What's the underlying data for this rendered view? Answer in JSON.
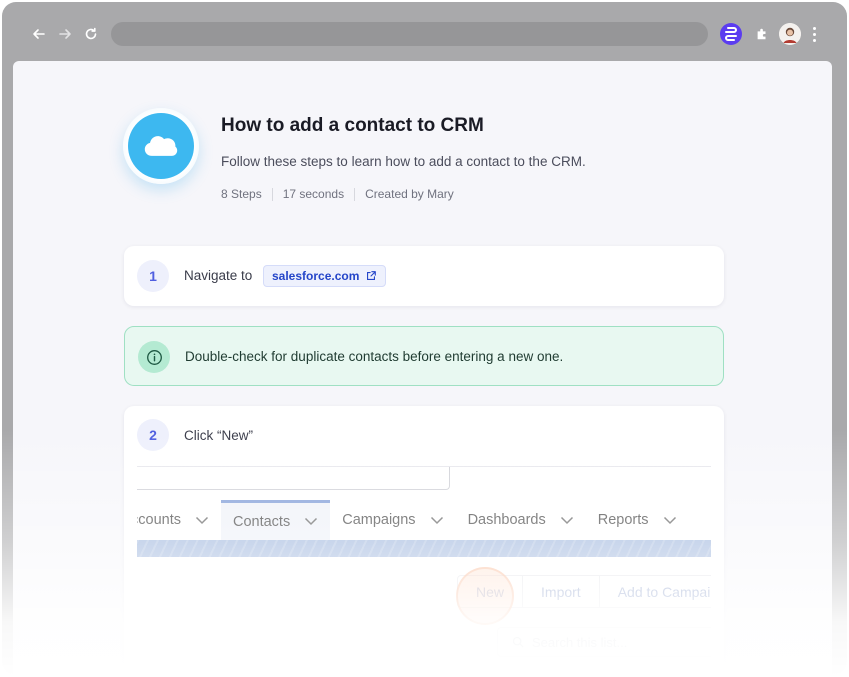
{
  "browser": {
    "back_icon": "arrow-left-icon",
    "forward_icon": "arrow-right-icon",
    "reload_icon": "reload-icon",
    "extension_icon": "scribe-logo-icon",
    "puzzle_icon": "puzzle-icon",
    "menu_icon": "kebab-menu-icon"
  },
  "guide": {
    "title": "How to add a contact to CRM",
    "description": "Follow these steps to learn how to add a contact to the CRM.",
    "meta": {
      "steps": "8 Steps",
      "duration": "17 seconds",
      "author": "Created by Mary"
    }
  },
  "steps": [
    {
      "number": "1",
      "text": "Navigate to",
      "link": "salesforce.com"
    },
    {
      "number": "2",
      "text": "Click “New”"
    }
  ],
  "tip": {
    "text": "Double-check for duplicate contacts before entering a new one."
  },
  "screenshot": {
    "tabs": [
      {
        "label": "ccounts",
        "active": false
      },
      {
        "label": "Contacts",
        "active": true
      },
      {
        "label": "Campaigns",
        "active": false
      },
      {
        "label": "Dashboards",
        "active": false
      },
      {
        "label": "Reports",
        "active": false
      }
    ],
    "buttons": [
      "New",
      "Import",
      "Add to Campai"
    ],
    "search_placeholder": "Search this list..."
  },
  "colors": {
    "accent": "#4f5ee0",
    "salesforce_blue": "#3db8f0",
    "tip_green": "#e8f8f1",
    "highlight": "#fdaa78"
  }
}
